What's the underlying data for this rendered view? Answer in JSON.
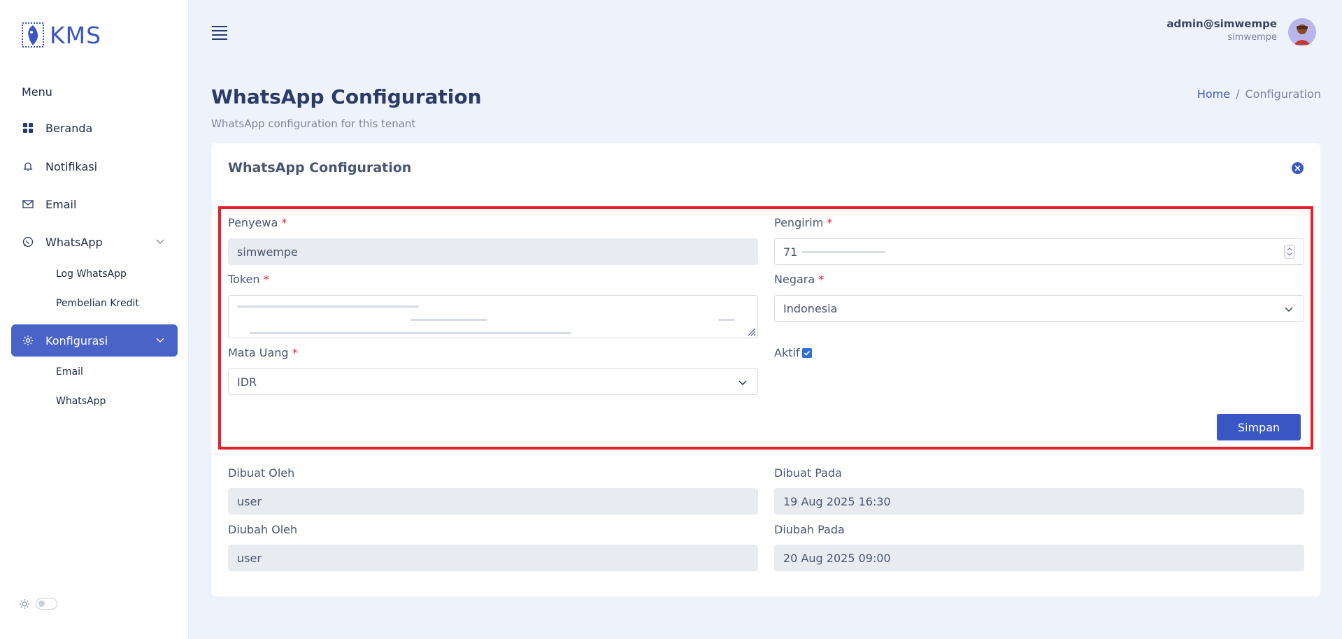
{
  "brand": {
    "name": "KMS"
  },
  "sidebar": {
    "heading": "Menu",
    "items": [
      {
        "label": "Beranda",
        "icon": "grid-icon"
      },
      {
        "label": "Notifikasi",
        "icon": "bell-icon"
      },
      {
        "label": "Email",
        "icon": "envelope-icon"
      },
      {
        "label": "WhatsApp",
        "icon": "whatsapp-icon",
        "subitems": [
          "Log WhatsApp",
          "Pembelian Kredit"
        ]
      },
      {
        "label": "Konfigurasi",
        "icon": "gear-icon",
        "active": true,
        "subitems": [
          "Email",
          "WhatsApp"
        ]
      }
    ],
    "accent_color": "#4a63c8"
  },
  "user": {
    "name": "admin@simwempe",
    "tenant": "simwempe"
  },
  "page": {
    "title": "WhatsApp Configuration",
    "subtitle": "WhatsApp configuration for this tenant",
    "breadcrumb": [
      "Home",
      "Configuration"
    ],
    "breadcrumb_separator": "/"
  },
  "card": {
    "title": "WhatsApp Configuration",
    "form": {
      "tenant_label": "Penyewa",
      "tenant_value": "simwempe",
      "sender_label": "Pengirim",
      "sender_value": "71",
      "token_label": "Token",
      "country_label": "Negara",
      "country_value": "Indonesia",
      "currency_label": "Mata Uang",
      "currency_value": "IDR",
      "active_label": "Aktif",
      "active_checked": true,
      "required_mark": "*",
      "save_label": "Simpan"
    },
    "audit": {
      "created_by_label": "Dibuat Oleh",
      "created_by_value": "user",
      "created_at_label": "Dibuat Pada",
      "created_at_value": "19 Aug 2025 16:30",
      "updated_by_label": "Diubah Oleh",
      "updated_by_value": "user",
      "updated_at_label": "Diubah Pada",
      "updated_at_value": "20 Aug 2025 09:00"
    }
  },
  "colors": {
    "primary": "#3a56c5",
    "highlight_border": "#e5202a",
    "required": "#e5202a"
  }
}
